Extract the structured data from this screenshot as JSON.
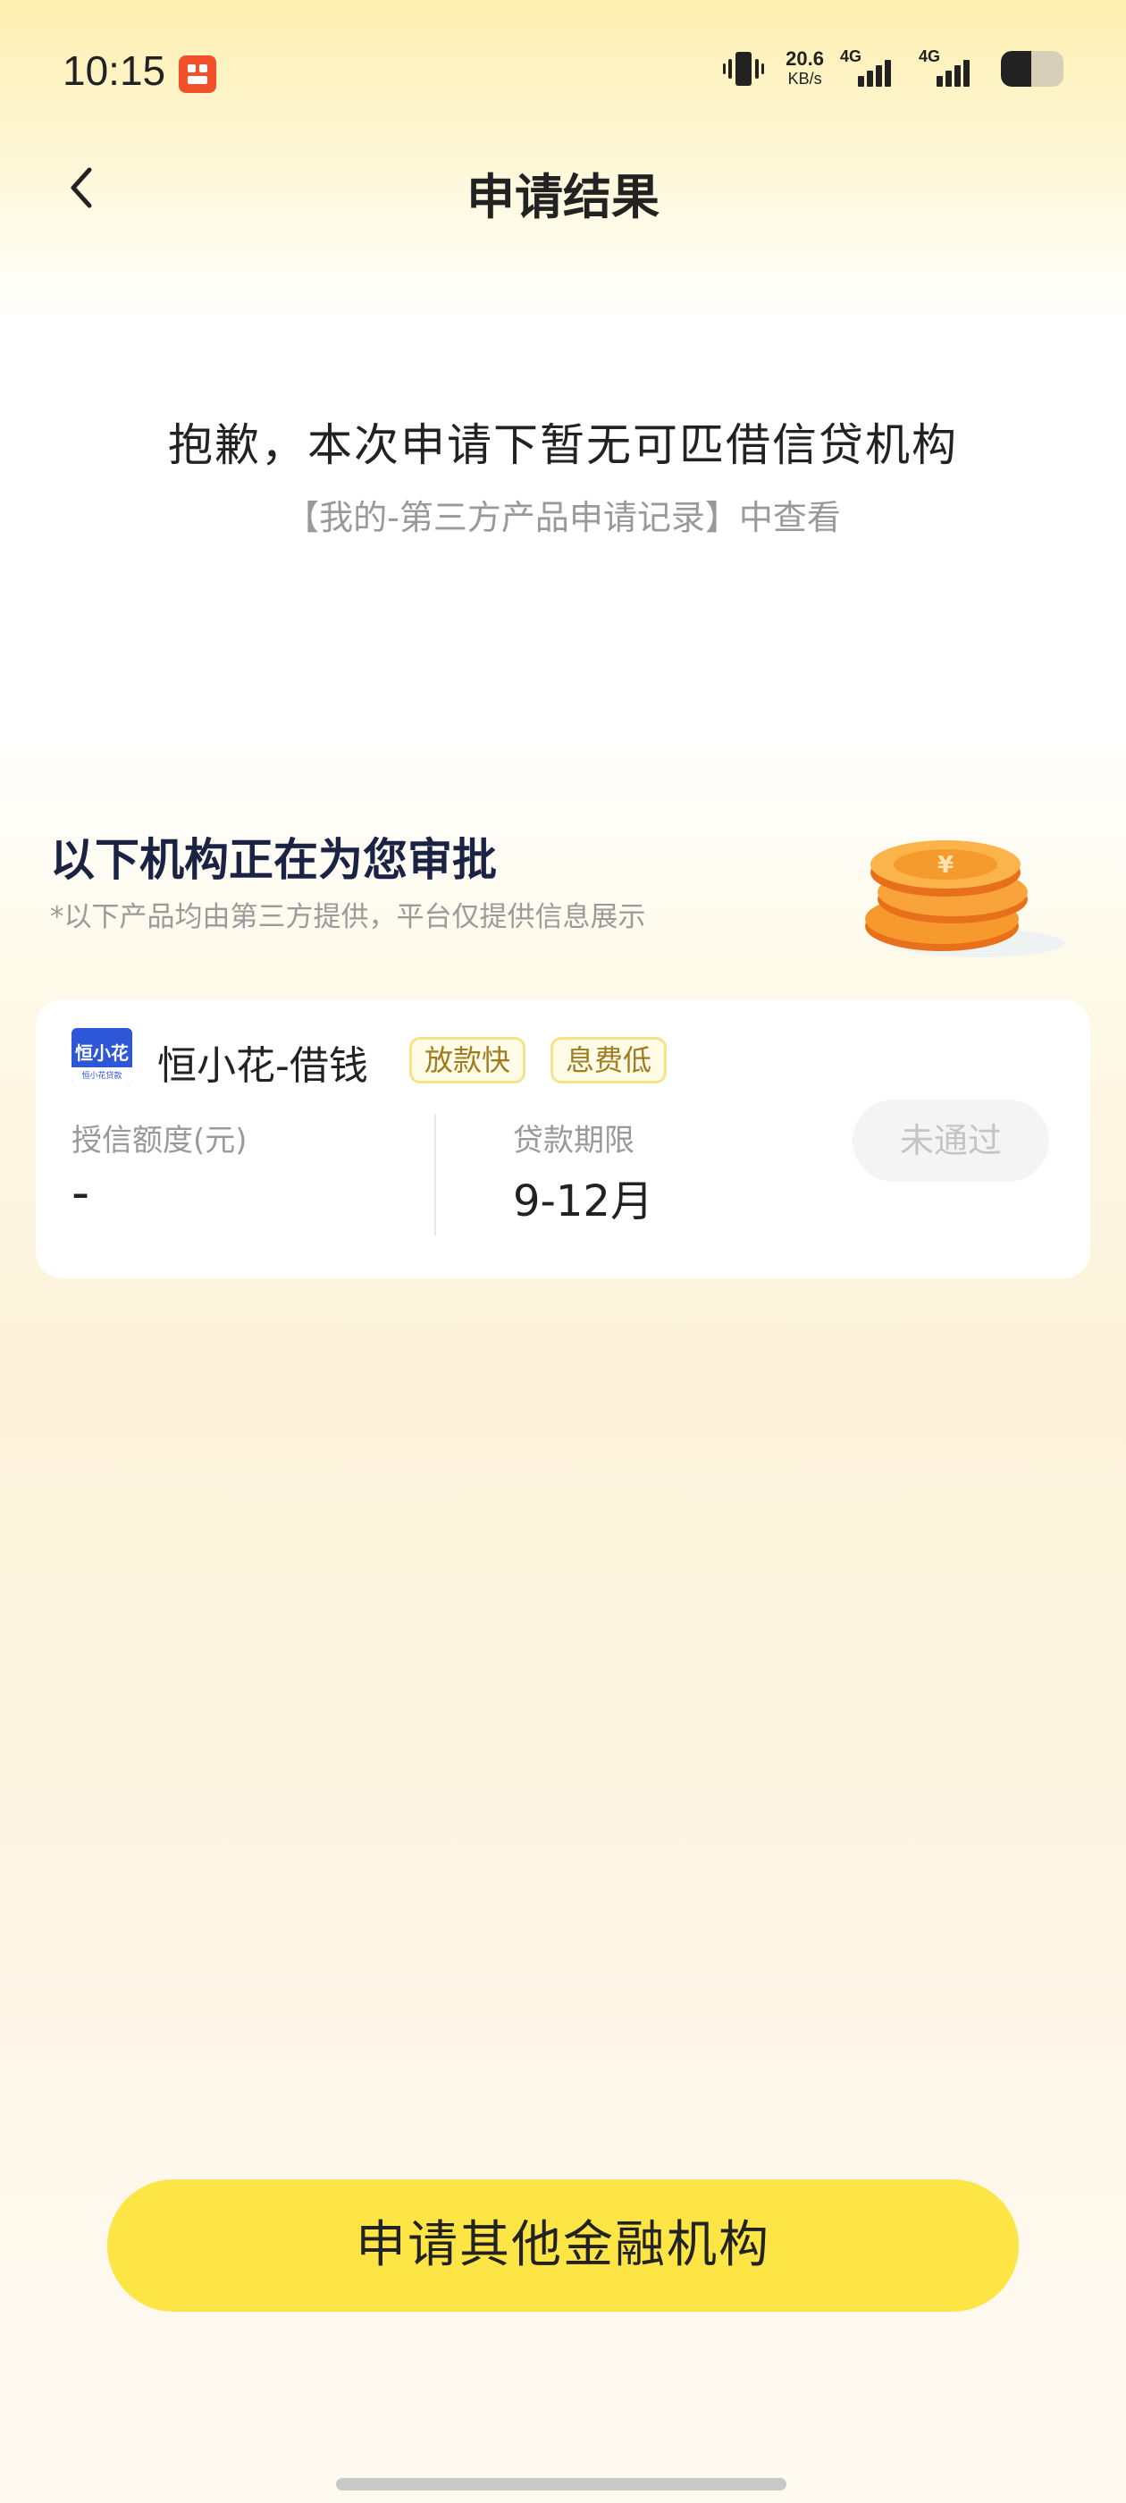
{
  "status_bar": {
    "time": "10:15",
    "net_speed_value": "20.6",
    "net_speed_unit": "KB/s",
    "signal1_label": "4G",
    "signal2_label": "4G",
    "battery_level": 0.48
  },
  "nav": {
    "title": "申请结果"
  },
  "result": {
    "headline": "抱歉，本次申请下暂无可匹借信贷机构",
    "subline": "【我的-第三方产品申请记录】中查看"
  },
  "section": {
    "title": "以下机构正在为您审批",
    "note": "*以下产品均由第三方提供，平台仅提供信息展示"
  },
  "product": {
    "logo_text": "恒小花",
    "logo_subtext": "恒小花贷款",
    "name": "恒小花-借钱",
    "tags": [
      "放款快",
      "息费低"
    ],
    "credit_label": "授信额度(元)",
    "credit_value": "-",
    "term_label": "贷款期限",
    "term_value": "9-12月",
    "status": "未通过"
  },
  "cta": {
    "label": "申请其他金融机构"
  },
  "colors": {
    "accent_yellow": "#fde545",
    "title_navy": "#1a2344",
    "logo_blue": "#2d57d6",
    "coin_orange": "#f7a033"
  }
}
